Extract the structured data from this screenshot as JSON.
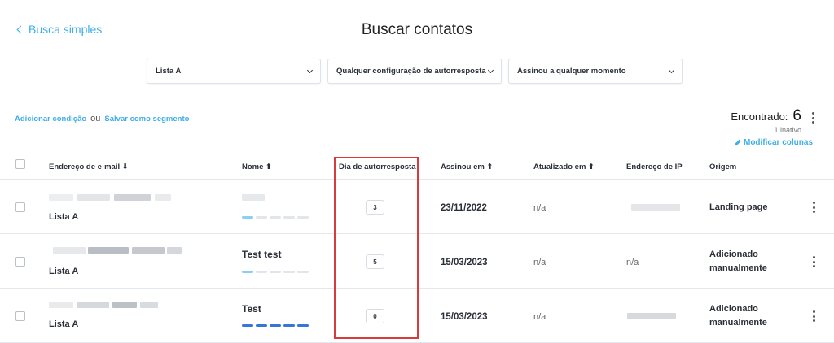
{
  "header": {
    "back_label": "Busca simples",
    "title": "Buscar contatos"
  },
  "filters": [
    {
      "value": "Lista A"
    },
    {
      "value": "Qualquer configuração de autorresposta"
    },
    {
      "value": "Assinou a qualquer momento"
    }
  ],
  "actions": {
    "add_condition": "Adicionar condição",
    "or": "ou",
    "save_segment": "Salvar como segmento"
  },
  "summary": {
    "found_label": "Encontrado:",
    "found_count": "6",
    "inactive": "1 inativo",
    "modify_columns": "Modificar colunas"
  },
  "columns": {
    "email": "Endereço de e-mail ⬇",
    "name": "Nome ⬆",
    "autoresponder_day": "Dia de autorresposta",
    "subscribed": "Assinou em ⬆",
    "updated": "Atualizado em ⬆",
    "ip": "Endereço de IP",
    "origin": "Origem"
  },
  "rows": [
    {
      "list": "Lista A",
      "name": "",
      "engagement": 1,
      "day": "3",
      "subscribed": "23/11/2022",
      "updated": "n/a",
      "ip": "",
      "origin_line1": "Landing page",
      "origin_line2": ""
    },
    {
      "list": "Lista A",
      "name": "Test test",
      "engagement": 1,
      "day": "5",
      "subscribed": "15/03/2023",
      "updated": "n/a",
      "ip": "n/a",
      "origin_line1": "Adicionado",
      "origin_line2": "manualmente"
    },
    {
      "list": "Lista A",
      "name": "Test",
      "engagement": 5,
      "day": "0",
      "subscribed": "15/03/2023",
      "updated": "n/a",
      "ip": "",
      "origin_line1": "Adicionado",
      "origin_line2": "manualmente"
    }
  ],
  "colors": {
    "accent": "#3eaee8",
    "highlight": "#d93a3a",
    "engagement_full": "#3576d6"
  }
}
